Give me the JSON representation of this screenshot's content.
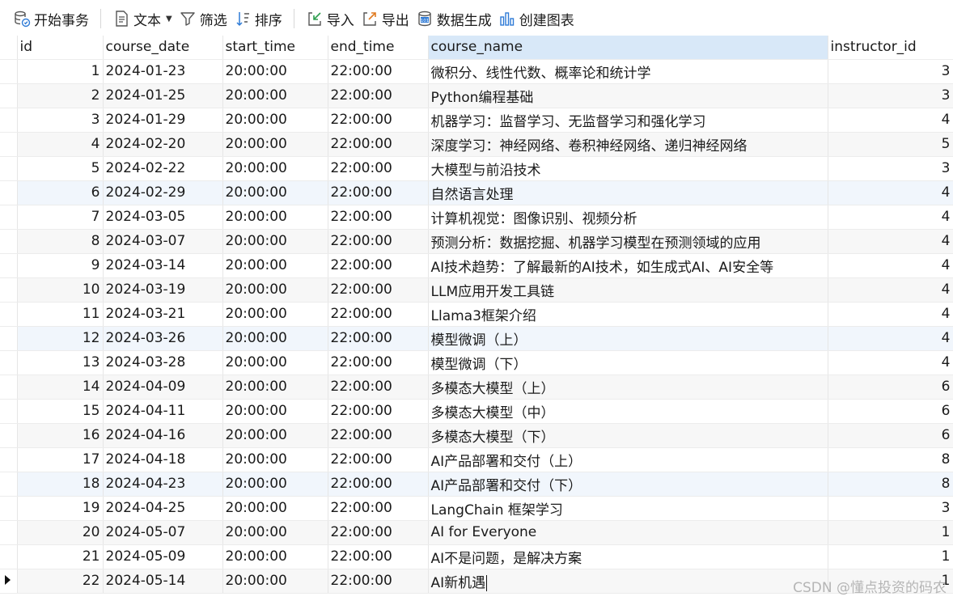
{
  "toolbar": {
    "begin_transaction": "开始事务",
    "text": "文本",
    "filter": "筛选",
    "sort": "排序",
    "import": "导入",
    "export": "导出",
    "data_generation": "数据生成",
    "create_chart": "创建图表"
  },
  "columns": [
    "id",
    "course_date",
    "start_time",
    "end_time",
    "course_name",
    "instructor_id"
  ],
  "rows": [
    [
      "1",
      "2024-01-23",
      "20:00:00",
      "22:00:00",
      "微积分、线性代数、概率论和统计学",
      "3"
    ],
    [
      "2",
      "2024-01-25",
      "20:00:00",
      "22:00:00",
      "Python编程基础",
      "3"
    ],
    [
      "3",
      "2024-01-29",
      "20:00:00",
      "22:00:00",
      "机器学习：监督学习、无监督学习和强化学习",
      "4"
    ],
    [
      "4",
      "2024-02-20",
      "20:00:00",
      "22:00:00",
      "深度学习：神经网络、卷积神经网络、递归神经网络",
      "5"
    ],
    [
      "5",
      "2024-02-22",
      "20:00:00",
      "22:00:00",
      "大模型与前沿技术",
      "3"
    ],
    [
      "6",
      "2024-02-29",
      "20:00:00",
      "22:00:00",
      "自然语言处理",
      "4"
    ],
    [
      "7",
      "2024-03-05",
      "20:00:00",
      "22:00:00",
      "计算机视觉：图像识别、视频分析",
      "4"
    ],
    [
      "8",
      "2024-03-07",
      "20:00:00",
      "22:00:00",
      "预测分析：数据挖掘、机器学习模型在预测领域的应用",
      "4"
    ],
    [
      "9",
      "2024-03-14",
      "20:00:00",
      "22:00:00",
      "AI技术趋势：了解最新的AI技术，如生成式AI、AI安全等",
      "4"
    ],
    [
      "10",
      "2024-03-19",
      "20:00:00",
      "22:00:00",
      "LLM应用开发工具链",
      "4"
    ],
    [
      "11",
      "2024-03-21",
      "20:00:00",
      "22:00:00",
      "Llama3框架介绍",
      "4"
    ],
    [
      "12",
      "2024-03-26",
      "20:00:00",
      "22:00:00",
      "模型微调（上）",
      "4"
    ],
    [
      "13",
      "2024-03-28",
      "20:00:00",
      "22:00:00",
      "模型微调（下）",
      "4"
    ],
    [
      "14",
      "2024-04-09",
      "20:00:00",
      "22:00:00",
      "多模态大模型（上）",
      "6"
    ],
    [
      "15",
      "2024-04-11",
      "20:00:00",
      "22:00:00",
      "多模态大模型（中）",
      "6"
    ],
    [
      "16",
      "2024-04-16",
      "20:00:00",
      "22:00:00",
      "多模态大模型（下）",
      "6"
    ],
    [
      "17",
      "2024-04-18",
      "20:00:00",
      "22:00:00",
      "AI产品部署和交付（上）",
      "8"
    ],
    [
      "18",
      "2024-04-23",
      "20:00:00",
      "22:00:00",
      "AI产品部署和交付（下）",
      "8"
    ],
    [
      "19",
      "2024-04-25",
      "20:00:00",
      "22:00:00",
      "LangChain 框架学习",
      "3"
    ],
    [
      "20",
      "2024-05-07",
      "20:00:00",
      "22:00:00",
      "AI for Everyone",
      "1"
    ],
    [
      "21",
      "2024-05-09",
      "20:00:00",
      "22:00:00",
      "AI不是问题，是解决方案",
      "1"
    ],
    [
      "22",
      "2024-05-14",
      "20:00:00",
      "22:00:00",
      "AI新机遇",
      "1"
    ]
  ],
  "selected_column": "course_name",
  "current_row": "22",
  "watermark": "CSDN @懂点投资的码农"
}
